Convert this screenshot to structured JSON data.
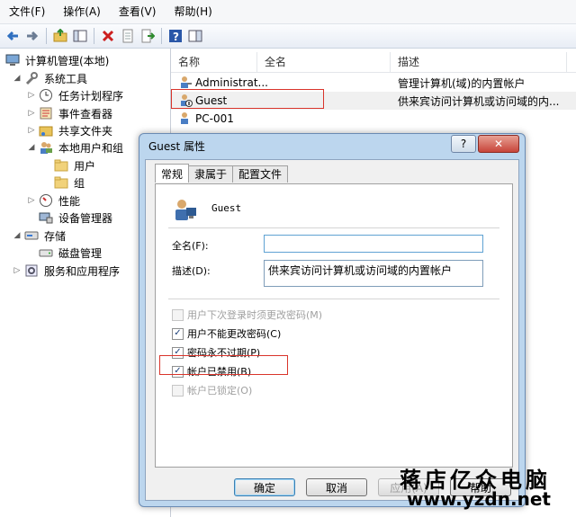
{
  "menu": [
    "文件(F)",
    "操作(A)",
    "查看(V)",
    "帮助(H)"
  ],
  "toolbar": {
    "icons": [
      "back-arrow-icon",
      "forward-arrow-icon",
      "up-folder-icon",
      "show-tree-icon",
      "delete-icon",
      "properties-icon",
      "export-icon",
      "help-icon",
      "panel-icon"
    ],
    "colors": {
      "back": "#2f6fc0",
      "delete": "#cc1f1f",
      "help": "#2a57a8"
    }
  },
  "tree": {
    "root": "计算机管理(本地)",
    "system_tools": "系统工具",
    "task_scheduler": "任务计划程序",
    "event_viewer": "事件查看器",
    "shared_folders": "共享文件夹",
    "local_users": "本地用户和组",
    "users": "用户",
    "groups": "组",
    "performance": "性能",
    "device_manager": "设备管理器",
    "storage": "存储",
    "disk_management": "磁盘管理",
    "services": "服务和应用程序"
  },
  "list": {
    "headers": {
      "name": "名称",
      "fullname": "全名",
      "desc": "描述"
    },
    "rows": [
      {
        "name": "Administrat...",
        "desc": "管理计算机(域)的内置帐户"
      },
      {
        "name": "Guest",
        "desc": "供来宾访问计算机或访问域的内..."
      },
      {
        "name": "PC-001",
        "desc": ""
      }
    ]
  },
  "dialog": {
    "title": "Guest 属性",
    "help_label": "?",
    "close_label": "✕",
    "tabs": [
      "常规",
      "隶属于",
      "配置文件"
    ],
    "username": "Guest",
    "fullname_label": "全名(F):",
    "fullname_value": "",
    "desc_label": "描述(D):",
    "desc_value": "供来宾访问计算机或访问域的内置帐户",
    "checks": [
      {
        "label": "用户下次登录时须更改密码(M)",
        "checked": false,
        "disabled": true
      },
      {
        "label": "用户不能更改密码(C)",
        "checked": true,
        "disabled": false
      },
      {
        "label": "密码永不过期(P)",
        "checked": true,
        "disabled": false
      },
      {
        "label": "帐户已禁用(B)",
        "checked": true,
        "disabled": false
      },
      {
        "label": "帐户已锁定(O)",
        "checked": false,
        "disabled": true
      }
    ],
    "buttons": {
      "ok": "确定",
      "cancel": "取消",
      "apply": "应用(A)",
      "help": "帮助"
    }
  },
  "watermark": {
    "line1": "蒋店亿众电脑",
    "line2": "www.yzdn.net"
  }
}
